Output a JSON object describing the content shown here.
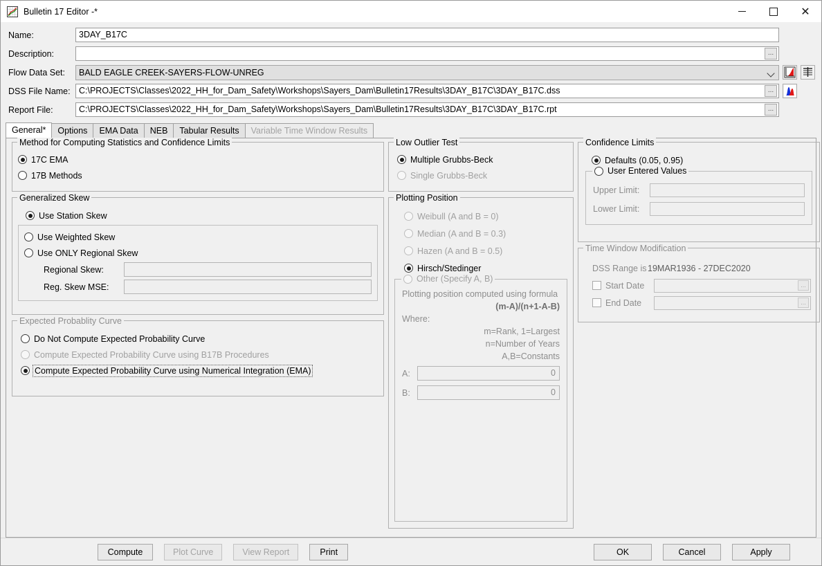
{
  "window": {
    "title": "Bulletin 17 Editor -*",
    "icon": "chart-line-icon",
    "controls": {
      "minimize": "minimize-icon",
      "maximize": "maximize-icon",
      "close": "close-icon"
    }
  },
  "header": {
    "name_label": "Name:",
    "name_value": "3DAY_B17C",
    "description_label": "Description:",
    "description_value": "",
    "flow_data_set_label": "Flow Data Set:",
    "flow_data_set_value": "BALD EAGLE CREEK-SAYERS-FLOW-UNREG",
    "dss_file_label": "DSS File Name:",
    "dss_file_value": "C:\\PROJECTS\\Classes\\2022_HH_for_Dam_Safety\\Workshops\\Sayers_Dam\\Bulletin17Results\\3DAY_B17C\\3DAY_B17C.dss",
    "report_file_label": "Report File:",
    "report_file_value": "C:\\PROJECTS\\Classes\\2022_HH_for_Dam_Safety\\Workshops\\Sayers_Dam\\Bulletin17Results\\3DAY_B17C\\3DAY_B17C.rpt",
    "browse_label": "...",
    "plot_icon": "red-curve-plot-icon",
    "table_icon": "table-lines-icon",
    "histogram_icon": "blue-red-histogram-icon"
  },
  "tabs": [
    {
      "label": "General*",
      "state": "active"
    },
    {
      "label": "Options",
      "state": "normal"
    },
    {
      "label": "EMA Data",
      "state": "normal"
    },
    {
      "label": "NEB",
      "state": "normal"
    },
    {
      "label": "Tabular Results",
      "state": "normal"
    },
    {
      "label": "Variable Time Window Results",
      "state": "disabled"
    }
  ],
  "method_group": {
    "title": "Method for Computing Statistics and Confidence Limits",
    "options": [
      {
        "label": "17C EMA",
        "checked": true
      },
      {
        "label": "17B Methods",
        "checked": false
      }
    ]
  },
  "skew_group": {
    "title": "Generalized Skew",
    "station_skew": {
      "label": "Use Station Skew",
      "checked": true
    },
    "weighted_skew": {
      "label": "Use Weighted Skew",
      "checked": false
    },
    "regional_only": {
      "label": "Use ONLY Regional Skew",
      "checked": false
    },
    "regional_skew_label": "Regional Skew:",
    "regional_skew_value": "",
    "reg_skew_mse_label": "Reg. Skew MSE:",
    "reg_skew_mse_value": ""
  },
  "epc_group": {
    "title": "Expected Probablity Curve",
    "options": [
      {
        "label": "Do Not Compute Expected Probability Curve",
        "checked": false,
        "disabled": false
      },
      {
        "label": "Compute Expected Probability Curve using B17B Procedures",
        "checked": false,
        "disabled": true
      },
      {
        "label": "Compute Expected Probability Curve using Numerical Integration (EMA)",
        "checked": true,
        "disabled": false,
        "focused": true
      }
    ]
  },
  "low_outlier_group": {
    "title": "Low Outlier Test",
    "options": [
      {
        "label": "Multiple Grubbs-Beck",
        "checked": true,
        "disabled": false
      },
      {
        "label": "Single Grubbs-Beck",
        "checked": false,
        "disabled": true
      }
    ]
  },
  "plotting_position_group": {
    "title": "Plotting Position",
    "options": [
      {
        "label": "Weibull (A and B = 0)",
        "checked": false,
        "disabled": true
      },
      {
        "label": "Median (A and B = 0.3)",
        "checked": false,
        "disabled": true
      },
      {
        "label": "Hazen (A and B = 0.5)",
        "checked": false,
        "disabled": true
      },
      {
        "label": "Hirsch/Stedinger",
        "checked": true,
        "disabled": false
      }
    ],
    "other": {
      "label": "Other (Specify A, B)",
      "checked": false,
      "disabled": true,
      "formula_intro": "Plotting position computed using formula",
      "formula": "(m-A)/(n+1-A-B)",
      "where_label": "Where:",
      "where_lines": [
        "m=Rank, 1=Largest",
        "n=Number of Years",
        "A,B=Constants"
      ],
      "a_label": "A:",
      "a_value": "0",
      "b_label": "B:",
      "b_value": "0"
    }
  },
  "confidence_limits_group": {
    "title": "Confidence Limits",
    "defaults": {
      "label": "Defaults (0.05, 0.95)",
      "checked": true
    },
    "user_entered": {
      "label": "User Entered Values",
      "checked": false
    },
    "upper_limit_label": "Upper Limit:",
    "upper_limit_value": "",
    "lower_limit_label": "Lower Limit:",
    "lower_limit_value": ""
  },
  "time_window_group": {
    "title": "Time Window Modification",
    "dss_range_label": "DSS Range is",
    "dss_range_value": "19MAR1936 - 27DEC2020",
    "start_date_label": "Start Date",
    "start_date_checked": false,
    "start_date_value": "",
    "end_date_label": "End Date",
    "end_date_checked": false,
    "end_date_value": "",
    "browse_label": "..."
  },
  "bottom_bar": {
    "compute": {
      "label": "Compute",
      "disabled": false
    },
    "plot_curve": {
      "label": "Plot Curve",
      "disabled": true
    },
    "view_report": {
      "label": "View Report",
      "disabled": true
    },
    "print": {
      "label": "Print",
      "disabled": false
    },
    "ok": {
      "label": "OK",
      "disabled": false
    },
    "cancel": {
      "label": "Cancel",
      "disabled": false
    },
    "apply": {
      "label": "Apply",
      "disabled": false
    }
  },
  "colors": {
    "background": "#f0f0f0",
    "field_border": "#9b9b9b",
    "disabled_text": "#a0a0a0",
    "accent_red": "#e02020",
    "accent_blue": "#1030d0"
  }
}
